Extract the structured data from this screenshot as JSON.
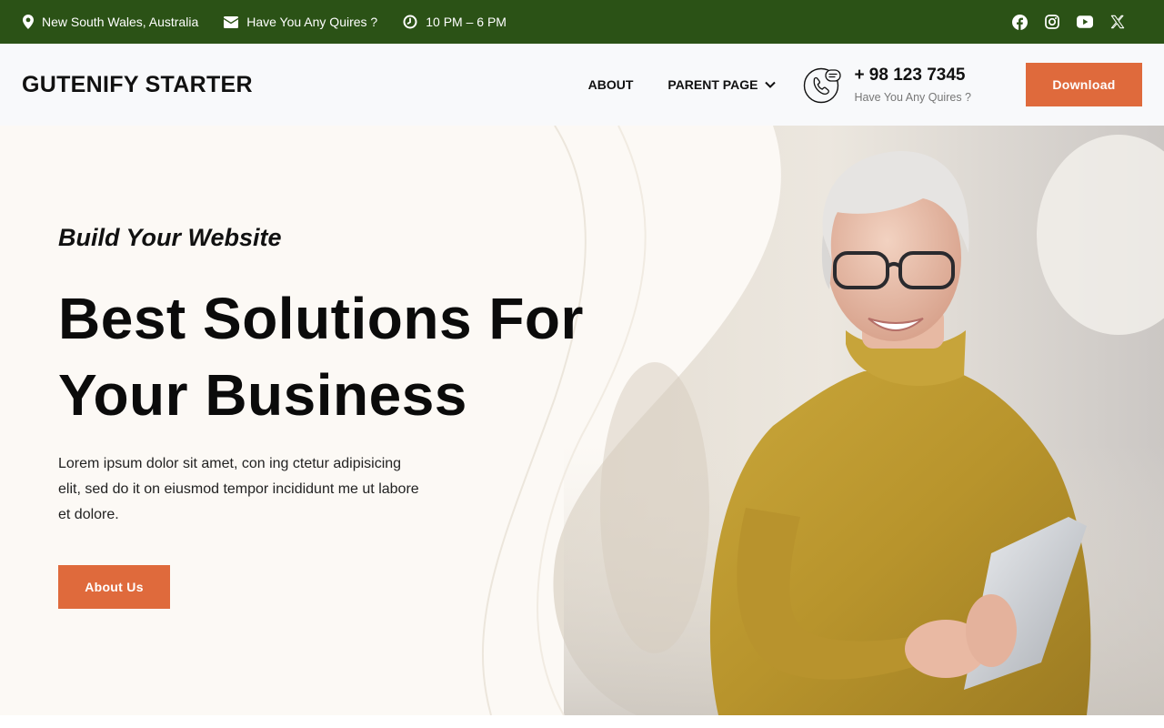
{
  "topbar": {
    "location": "New South Wales, Australia",
    "email": "Have You Any Quires ?",
    "hours": "10 PM – 6 PM",
    "icons": [
      "map-pin-icon",
      "envelope-icon",
      "clock-icon"
    ],
    "social": [
      "facebook-icon",
      "instagram-icon",
      "youtube-icon",
      "x-twitter-icon"
    ],
    "color": "#2b5216"
  },
  "header": {
    "logo": "GUTENIFY STARTER",
    "nav": [
      "ABOUT",
      "PARENT PAGE"
    ],
    "phone": "+ 98 123 7345",
    "phone_sub": "Have You Any Quires ?",
    "download_label": "Download",
    "accent": "#df6a3c"
  },
  "hero": {
    "eyebrow": "Build Your Website",
    "title": "Best Solutions For Your Business",
    "description": "Lorem ipsum dolor sit amet, con ing ctetur adipisicing elit, sed do it on eiusmod tempor incididunt me ut labore et dolore.",
    "button_label": "About Us"
  }
}
